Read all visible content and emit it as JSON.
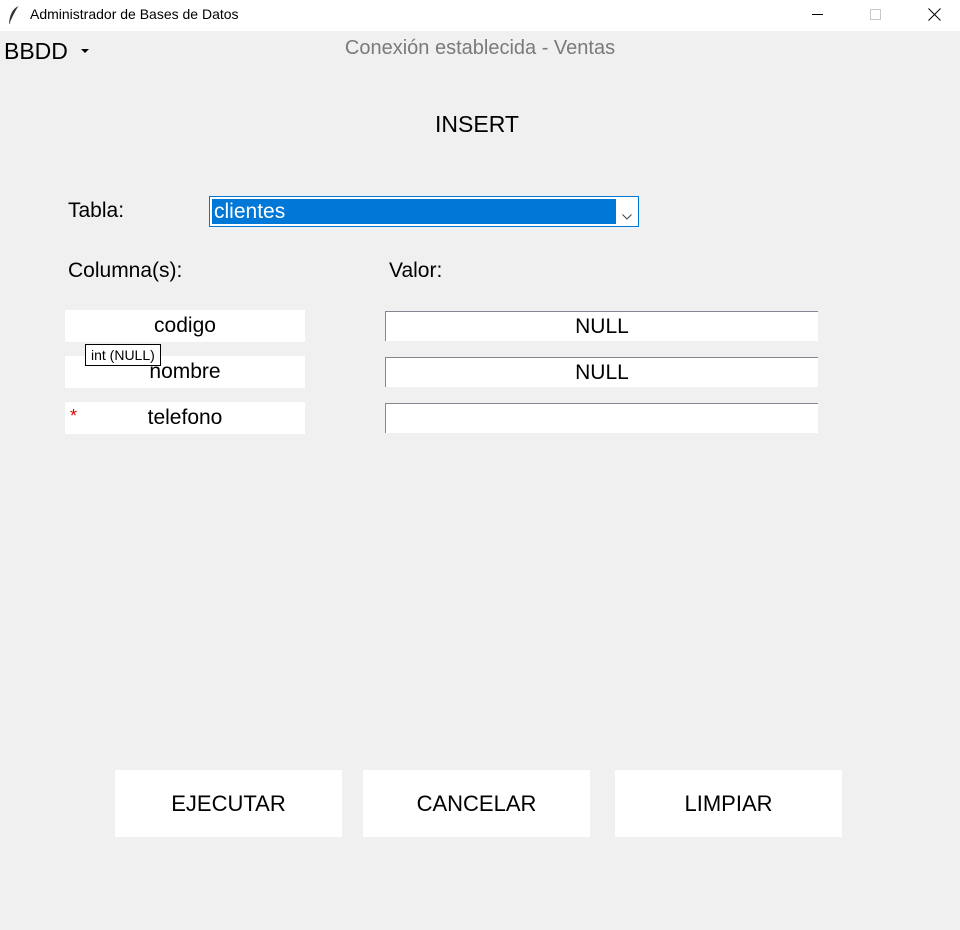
{
  "window": {
    "title": "Administrador de Bases de Datos",
    "icon": "feather-icon",
    "controls": [
      "minimize-icon",
      "maximize-icon",
      "close-icon"
    ]
  },
  "menu": {
    "bbdd_label": "BBDD",
    "icon": "caret-down-icon"
  },
  "status": {
    "text": "Conexión establecida - Ventas"
  },
  "form": {
    "title": "INSERT",
    "table_label": "Tabla:",
    "table_selected": "clientes",
    "columns_label": "Columna(s):",
    "value_label": "Valor:",
    "rows": [
      {
        "column": "codigo",
        "value": "NULL",
        "required": false
      },
      {
        "column": "nombre",
        "value": "NULL",
        "required": false
      },
      {
        "column": "telefono",
        "value": "",
        "required": true,
        "required_mark": "*"
      }
    ],
    "tooltip": "int (NULL)"
  },
  "buttons": {
    "execute": "EJECUTAR",
    "cancel": "CANCELAR",
    "clear": "LIMPIAR"
  },
  "colors": {
    "background": "#f0f0f0",
    "accent": "#0078d7",
    "status_text": "#7a7a7a",
    "required": "#e00000"
  }
}
